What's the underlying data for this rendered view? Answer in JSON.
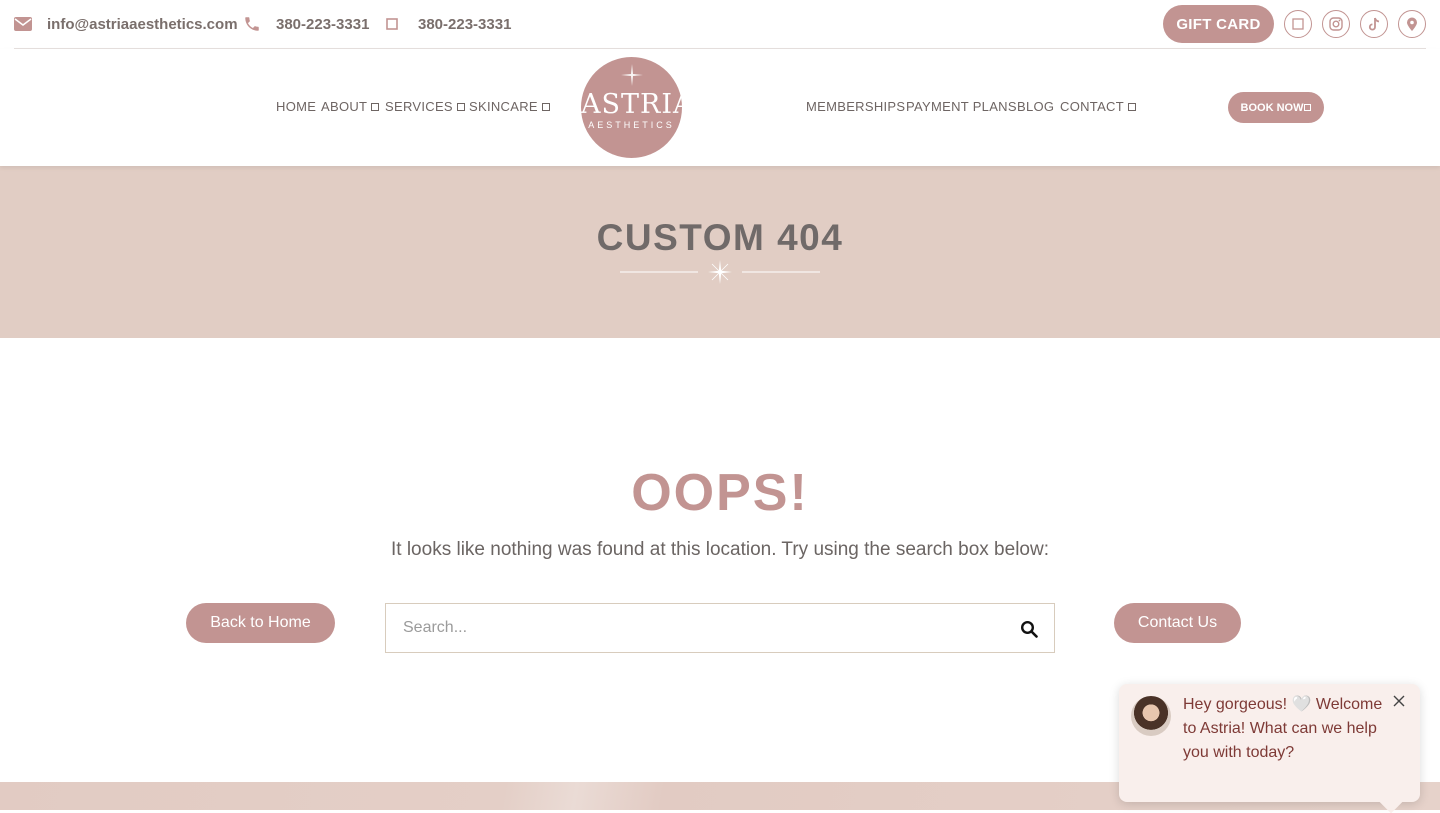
{
  "topbar": {
    "email": "info@astriaaesthetics.com",
    "phone1": "380-223-3331",
    "phone2": "380-223-3331",
    "gift_card": "GIFT CARD",
    "icons": [
      "envelope-icon",
      "phone-icon",
      "square-icon",
      "social-square-icon",
      "instagram-icon",
      "tiktok-icon",
      "location-pin-icon"
    ]
  },
  "nav": {
    "left": [
      "HOME",
      "ABOUT",
      "SERVICES",
      "SKINCARE"
    ],
    "right": [
      "MEMBERSHIPS",
      "PAYMENT PLANS",
      "BLOG",
      "CONTACT"
    ],
    "logo_name": "ASTRIA",
    "logo_sub": "AESTHETICS",
    "book_now": "BOOK NOW"
  },
  "hero": {
    "title": "CUSTOM 404"
  },
  "main": {
    "heading": "OOPS!",
    "message": "It looks like nothing was found at this location. Try using the search box below:",
    "back_home": "Back to Home",
    "contact_us": "Contact Us",
    "search_placeholder": "Search..."
  },
  "chat": {
    "message": "Hey gorgeous! 🤍 Welcome to Astria! What can we help you with today?"
  },
  "colors": {
    "accent": "#c29492",
    "hero_bg": "#e1cdc4",
    "text": "#6b6563",
    "chat_bg": "#f9efec",
    "chat_text": "#7e3a36"
  }
}
